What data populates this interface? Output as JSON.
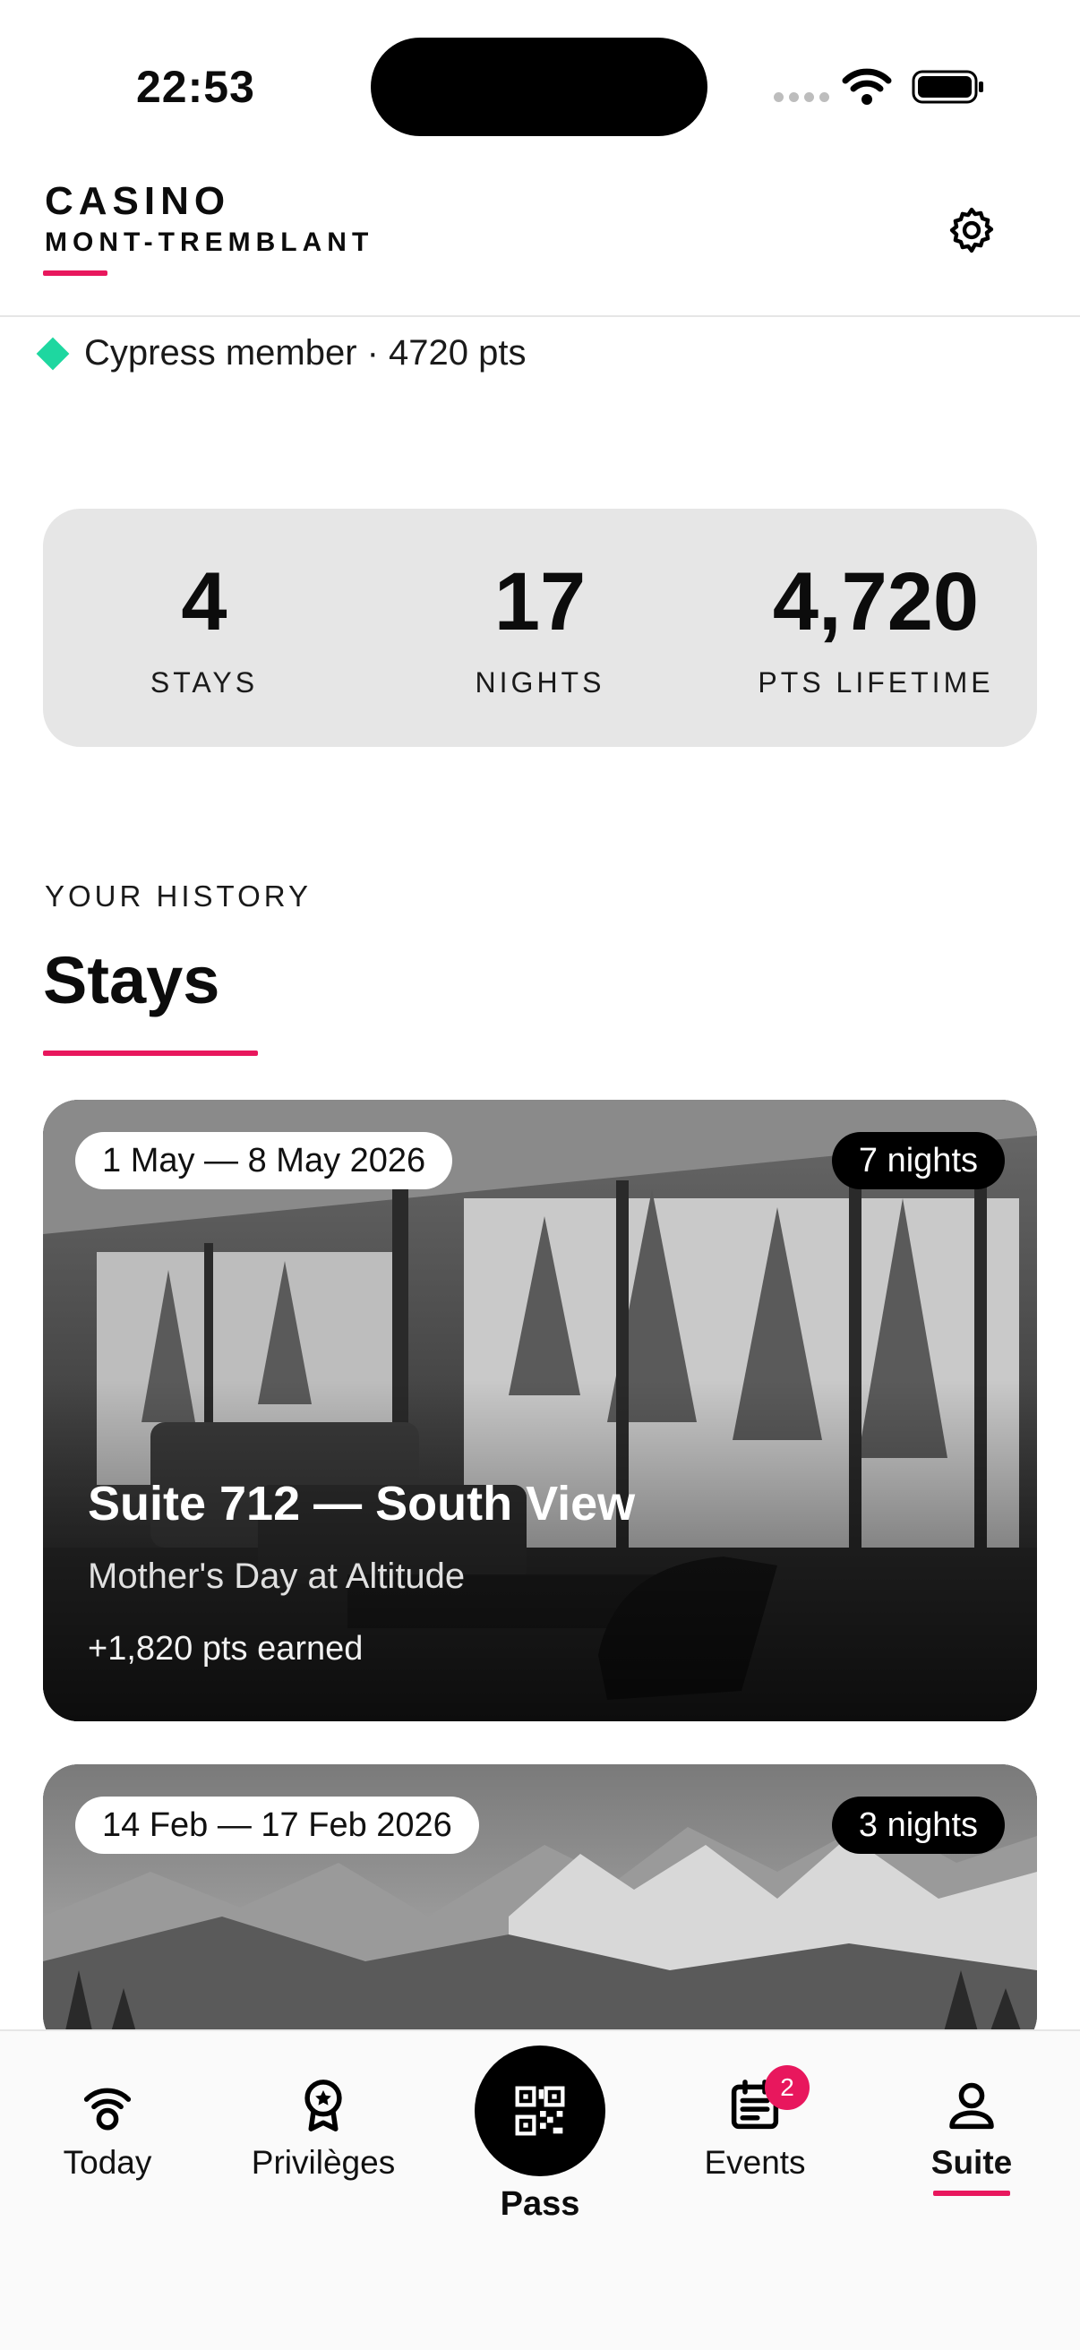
{
  "status_bar": {
    "time": "22:53"
  },
  "header": {
    "brand_line1": "CASINO",
    "brand_line2": "MONT-TREMBLANT",
    "settings_icon": "gear-icon"
  },
  "membership": {
    "text": "Cypress member · 4720 pts",
    "accent": "#1ed7a0"
  },
  "stats": [
    {
      "value": "4",
      "label": "STAYS"
    },
    {
      "value": "17",
      "label": "NIGHTS"
    },
    {
      "value": "4,720",
      "label": "PTS LIFETIME"
    }
  ],
  "history": {
    "eyebrow": "YOUR HISTORY",
    "title": "Stays",
    "stays": [
      {
        "dates": "1 May — 8 May 2026",
        "nights": "7 nights",
        "title": "Suite 712 — South View",
        "subtitle": "Mother's Day at Altitude",
        "points": "+1,820 pts earned"
      },
      {
        "dates": "14 Feb — 17 Feb 2026",
        "nights": "3 nights"
      }
    ]
  },
  "tabs": [
    {
      "label": "Today",
      "icon": "wifi-ring-icon"
    },
    {
      "label": "Privilèges",
      "icon": "award-star-icon"
    },
    {
      "label": "Pass",
      "icon": "qr-code-icon"
    },
    {
      "label": "Events",
      "icon": "calendar-list-icon",
      "badge": "2"
    },
    {
      "label": "Suite",
      "icon": "person-icon",
      "active": true
    }
  ],
  "colors": {
    "accent": "#e8175d",
    "stats_bg": "#e6e6e6"
  }
}
